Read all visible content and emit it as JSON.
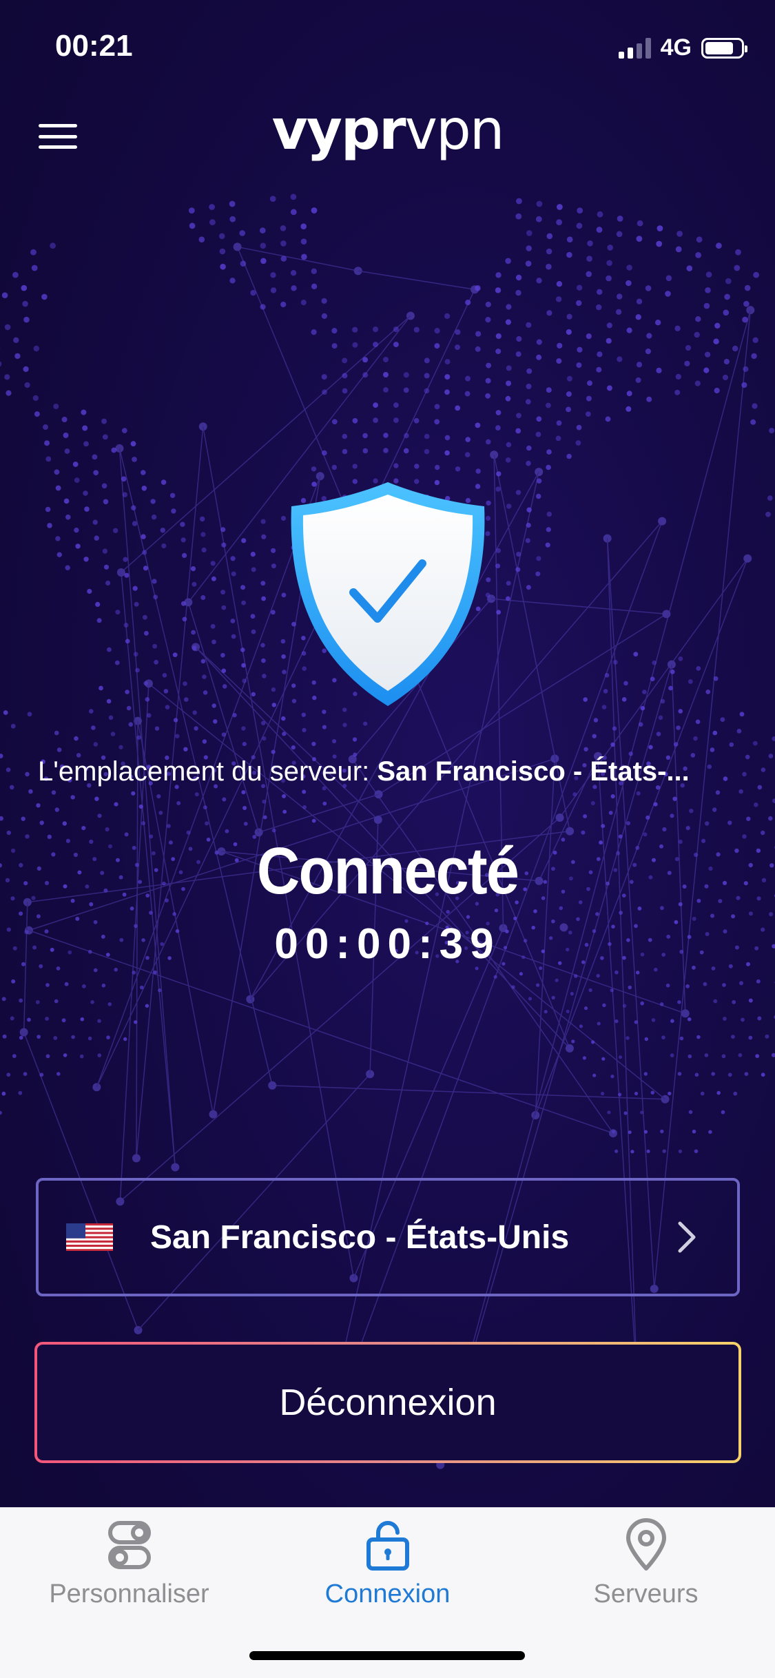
{
  "status_bar": {
    "time": "00:21",
    "network": "4G",
    "signal_bars": 2,
    "signal_bars_total": 4,
    "battery_level": 0.8
  },
  "header": {
    "logo_bold": "vypr",
    "logo_light": "vpn",
    "menu_icon": "hamburger-menu-icon"
  },
  "status": {
    "shield_icon": "shield-check-icon",
    "location_label": "L'emplacement du serveur: ",
    "location_value": "San Francisco - États-...",
    "state": "Connecté",
    "timer": "00:00:39"
  },
  "server": {
    "flag_icon": "us-flag-icon",
    "name": "San Francisco - États-Unis",
    "chevron_icon": "chevron-right-icon"
  },
  "actions": {
    "disconnect_label": "Déconnexion"
  },
  "tabs": [
    {
      "label": "Personnaliser",
      "icon": "toggles-icon",
      "active": false
    },
    {
      "label": "Connexion",
      "icon": "lock-open-icon",
      "active": true
    },
    {
      "label": "Serveurs",
      "icon": "map-pin-icon",
      "active": false
    }
  ],
  "colors": {
    "background": "#150a46",
    "globe_dots": "#5b3fd6",
    "active_tab": "#1f7ad6",
    "inactive_tab": "#8e8e93",
    "shield_blue": "#2aa7f5",
    "server_border": "#6d65c4"
  }
}
